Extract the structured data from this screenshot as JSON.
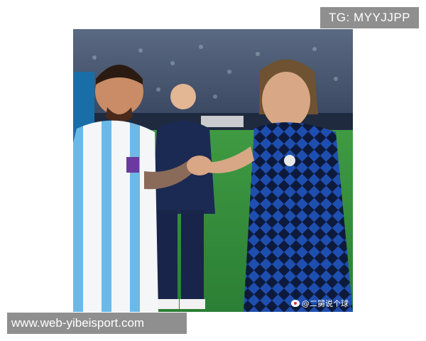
{
  "overlays": {
    "tg_handle": "TG: MYYJJPP",
    "site_url": "www.web-yibeisport.com",
    "photo_watermark": "@二舅说个球"
  },
  "photo": {
    "subject": "two football players shaking hands on a stadium pitch",
    "colors": {
      "pitch": "#2f8a3a",
      "crowd": "#3a4a63",
      "argentina_stripe": "#6cb8e6",
      "croatia_check_dark": "#0e1a3c",
      "croatia_check_light": "#1e4fb0",
      "staff_tracksuit": "#1b2a52"
    }
  }
}
